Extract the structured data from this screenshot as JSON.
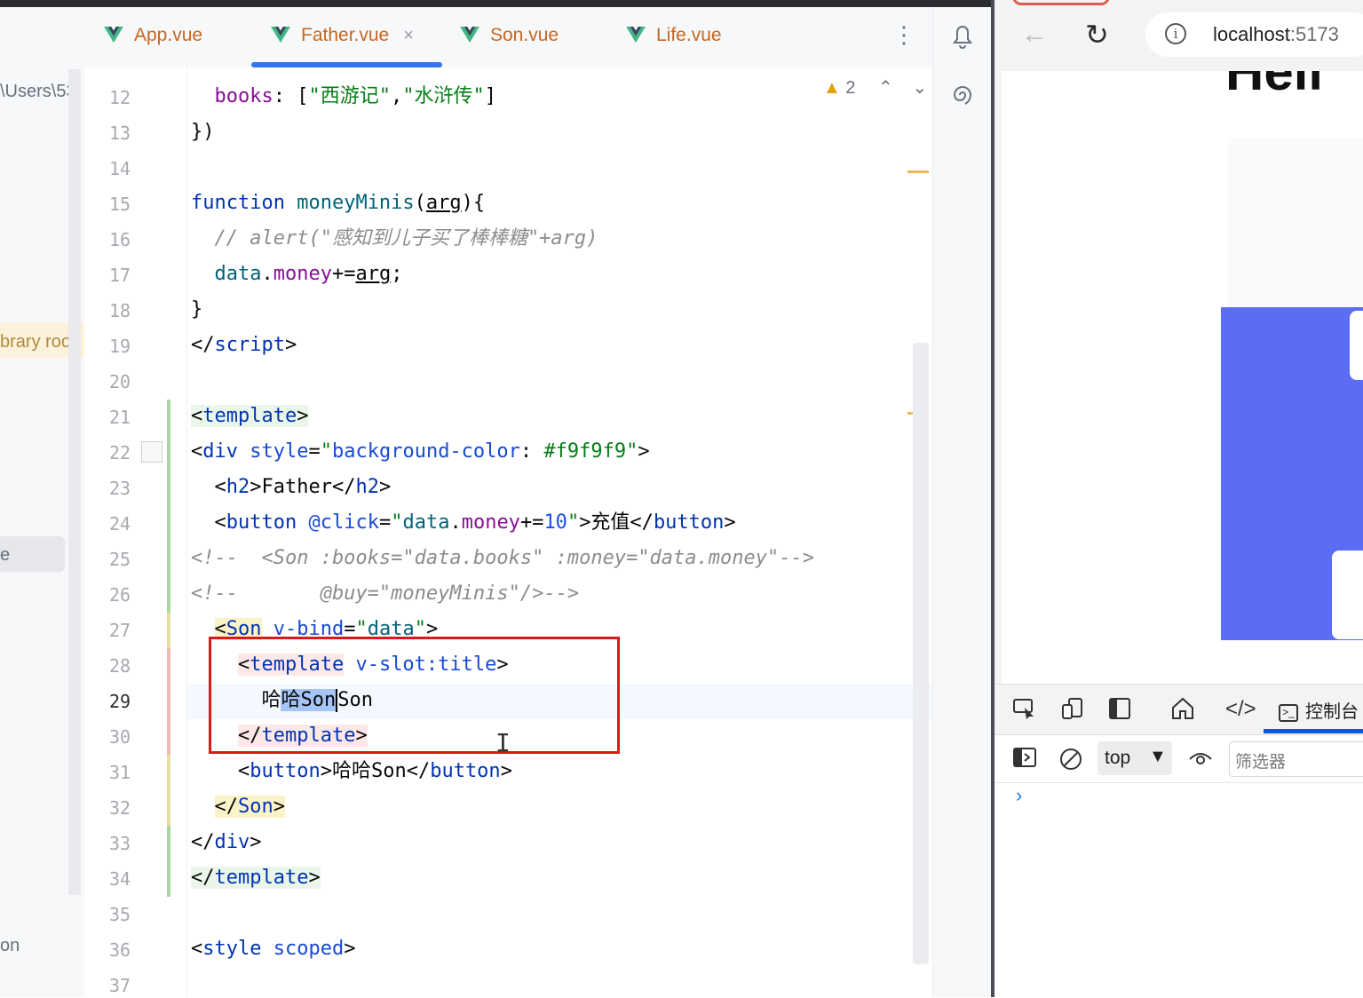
{
  "sidebar": {
    "texts": [
      "\\Users\\53",
      "brary roo",
      "e",
      "on"
    ]
  },
  "tabs": [
    {
      "label": "App.vue",
      "active": false
    },
    {
      "label": "Father.vue",
      "active": true,
      "close": "×"
    },
    {
      "label": "Son.vue",
      "active": false
    },
    {
      "label": "Life.vue",
      "active": false
    }
  ],
  "tabs_more": "⋮",
  "inspection": {
    "count": "2",
    "up": "⌃",
    "down": "⌄"
  },
  "editor": {
    "line_numbers": [
      "12",
      "13",
      "14",
      "15",
      "16",
      "17",
      "18",
      "19",
      "20",
      "21",
      "22",
      "23",
      "24",
      "25",
      "26",
      "27",
      "28",
      "29",
      "30",
      "31",
      "32",
      "33",
      "34",
      "35",
      "36",
      "37"
    ],
    "current_line": "29",
    "cursor_glyph": "I"
  },
  "browser": {
    "url_host": "localhost",
    "url_port": ":5173",
    "heading_fragment": "Hell",
    "accent": "#5b6cf5"
  },
  "devtools": {
    "console_label": "控制台",
    "context_value": "top",
    "filter_placeholder": "筛选器",
    "prompt": "›"
  }
}
